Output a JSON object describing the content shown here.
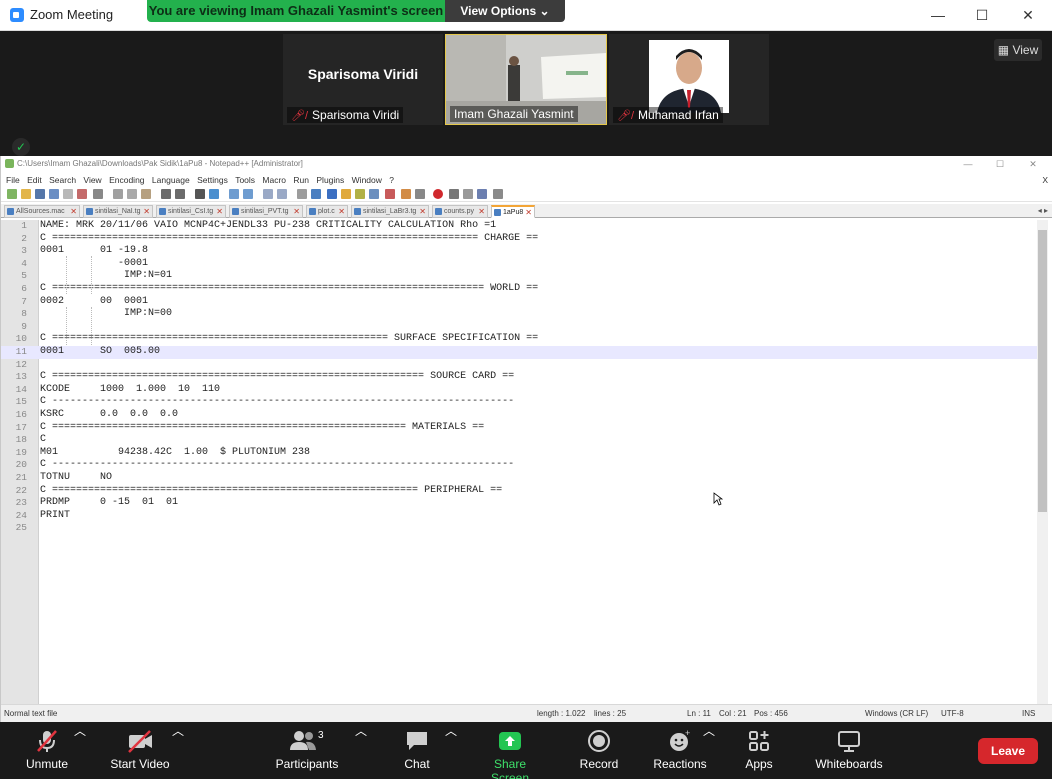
{
  "window": {
    "title": "Zoom Meeting",
    "share_banner": "You are viewing Imam Ghazali Yasmint's screen",
    "view_options": "View Options",
    "minimize": "—",
    "maximize": "☐",
    "close": "✕"
  },
  "video": {
    "view_label": "View",
    "tiles": [
      {
        "display_name": "Sparisoma Viridi",
        "label": "Sparisoma Viridi"
      },
      {
        "label": "Imam Ghazali Yasmint"
      },
      {
        "label": "Muhamad Irfan"
      }
    ]
  },
  "npp": {
    "title": "C:\\Users\\Imam Ghazali\\Downloads\\Pak Sidik\\1aPu8 - Notepad++ [Administrator]",
    "menu": [
      "File",
      "Edit",
      "Search",
      "View",
      "Encoding",
      "Language",
      "Settings",
      "Tools",
      "Macro",
      "Run",
      "Plugins",
      "Window",
      "?"
    ],
    "menu_close": "X",
    "tabs": [
      "AllSources.mac",
      "sintilasi_NaI.tg",
      "sintilasi_CsI.tg",
      "sintilasi_PVT.tg",
      "plot.c",
      "sintilasi_LaBr3.tg",
      "counts.py",
      "1aPu8"
    ],
    "lines": [
      "NAME: MRK 20/11/06 VAIO MCNP4C+JENDL33 PU-238 CRITICALITY CALCULATION Rho =1",
      "C ======================================================================= CHARGE ==",
      "0001      01 -19.8",
      "             -0001",
      "              IMP:N=01",
      "C ======================================================================== WORLD ==",
      "0002      00  0001",
      "              IMP:N=00",
      "",
      "C ======================================================== SURFACE SPECIFICATION ==",
      "0001      SO  005.00",
      "",
      "C ============================================================== SOURCE CARD ==",
      "KCODE     1000  1.000  10  110",
      "C -----------------------------------------------------------------------------",
      "KSRC      0.0  0.0  0.0",
      "C =========================================================== MATERIALS ==",
      "C",
      "M01          94238.42C  1.00  $ PLUTONIUM 238",
      "C -----------------------------------------------------------------------------",
      "TOTNU     NO",
      "C ============================================================= PERIPHERAL ==",
      "PRDMP     0 -15  01  01",
      "PRINT",
      ""
    ],
    "current_line": 11,
    "status": {
      "type": "Normal text file",
      "length": "length : 1.022",
      "lines": "lines : 25",
      "ln": "Ln : 11",
      "col": "Col : 21",
      "pos": "Pos : 456",
      "eol": "Windows (CR LF)",
      "encoding": "UTF-8",
      "mode": "INS"
    }
  },
  "toolbar": {
    "unmute": "Unmute",
    "start_video": "Start Video",
    "participants": "Participants",
    "participants_count": "3",
    "chat": "Chat",
    "share_screen": "Share Screen",
    "record": "Record",
    "reactions": "Reactions",
    "apps": "Apps",
    "whiteboards": "Whiteboards",
    "leave": "Leave"
  },
  "colors": {
    "share_green": "#23b14d",
    "leave_red": "#d6272c",
    "tab_active_accent": "#f3a536"
  }
}
